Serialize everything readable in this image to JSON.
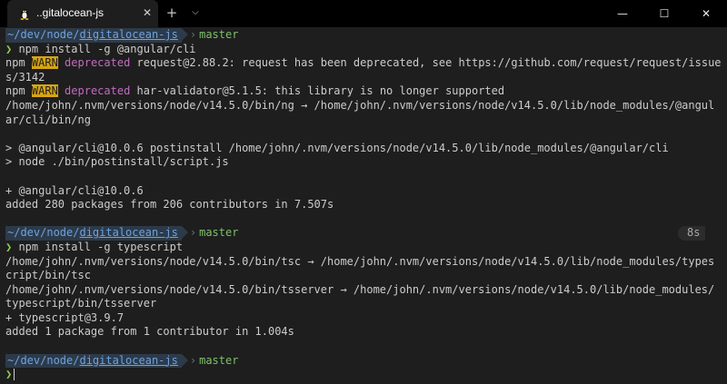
{
  "window": {
    "tab_title": "..gitalocean-js",
    "tab_icon": "linux-penguin-icon",
    "close_glyph": "✕",
    "new_tab_glyph": "+",
    "dropdown_glyph": "⌵",
    "minimize_glyph": "—",
    "maximize_glyph": "☐",
    "window_close_glyph": "✕"
  },
  "prompt": {
    "path_prefix": "~/dev/node/",
    "path_dir": "digitalocean-js",
    "branch_sep": "›",
    "branch": "master",
    "chevron": "❯"
  },
  "terminal": {
    "lines": [
      {
        "kind": "prompt"
      },
      {
        "kind": "cmd",
        "text": "npm install -g @angular/cli"
      },
      {
        "kind": "warn",
        "pre": "npm ",
        "warn": "WARN",
        "depr": "deprecated",
        "rest": " request@2.88.2: request has been deprecated, see https://github.com/request/request/issue"
      },
      {
        "kind": "text",
        "text": "s/3142"
      },
      {
        "kind": "warn",
        "pre": "npm ",
        "warn": "WARN",
        "depr": "deprecated",
        "rest": " har-validator@5.1.5: this library is no longer supported"
      },
      {
        "kind": "text",
        "text": "/home/john/.nvm/versions/node/v14.5.0/bin/ng → /home/john/.nvm/versions/node/v14.5.0/lib/node_modules/@angul"
      },
      {
        "kind": "text",
        "text": "ar/cli/bin/ng"
      },
      {
        "kind": "blank"
      },
      {
        "kind": "text",
        "text": "> @angular/cli@10.0.6 postinstall /home/john/.nvm/versions/node/v14.5.0/lib/node_modules/@angular/cli"
      },
      {
        "kind": "text",
        "text": "> node ./bin/postinstall/script.js"
      },
      {
        "kind": "blank"
      },
      {
        "kind": "text",
        "text": "+ @angular/cli@10.0.6"
      },
      {
        "kind": "text",
        "text": "added 280 packages from 206 contributors in 7.507s"
      },
      {
        "kind": "blank"
      },
      {
        "kind": "prompt",
        "duration": "8s"
      },
      {
        "kind": "cmd",
        "text": "npm install -g typescript"
      },
      {
        "kind": "text",
        "text": "/home/john/.nvm/versions/node/v14.5.0/bin/tsc → /home/john/.nvm/versions/node/v14.5.0/lib/node_modules/types"
      },
      {
        "kind": "text",
        "text": "cript/bin/tsc"
      },
      {
        "kind": "text",
        "text": "/home/john/.nvm/versions/node/v14.5.0/bin/tsserver → /home/john/.nvm/versions/node/v14.5.0/lib/node_modules/"
      },
      {
        "kind": "text",
        "text": "typescript/bin/tsserver"
      },
      {
        "kind": "text",
        "text": "+ typescript@3.9.7"
      },
      {
        "kind": "text",
        "text": "added 1 package from 1 contributor in 1.004s"
      },
      {
        "kind": "blank"
      },
      {
        "kind": "prompt"
      },
      {
        "kind": "input"
      }
    ]
  }
}
